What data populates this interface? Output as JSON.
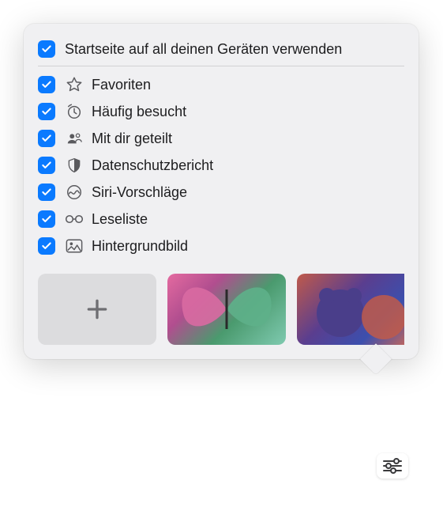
{
  "header": {
    "label": "Startseite auf all deinen Geräten verwenden",
    "checked": true
  },
  "options": [
    {
      "key": "favoriten",
      "label": "Favoriten",
      "icon": "star-icon",
      "checked": true
    },
    {
      "key": "haeufig",
      "label": "Häufig besucht",
      "icon": "clock-icon",
      "checked": true
    },
    {
      "key": "geteilt",
      "label": "Mit dir geteilt",
      "icon": "shared-icon",
      "checked": true
    },
    {
      "key": "datenschutz",
      "label": "Datenschutzbericht",
      "icon": "shield-icon",
      "checked": true
    },
    {
      "key": "siri",
      "label": "Siri-Vorschläge",
      "icon": "siri-icon",
      "checked": true
    },
    {
      "key": "leseliste",
      "label": "Leseliste",
      "icon": "glasses-icon",
      "checked": true
    },
    {
      "key": "hintergrund",
      "label": "Hintergrundbild",
      "icon": "image-icon",
      "checked": true
    }
  ],
  "thumbnails": {
    "add_label": "+",
    "items": [
      "add",
      "butterfly",
      "bear"
    ]
  }
}
